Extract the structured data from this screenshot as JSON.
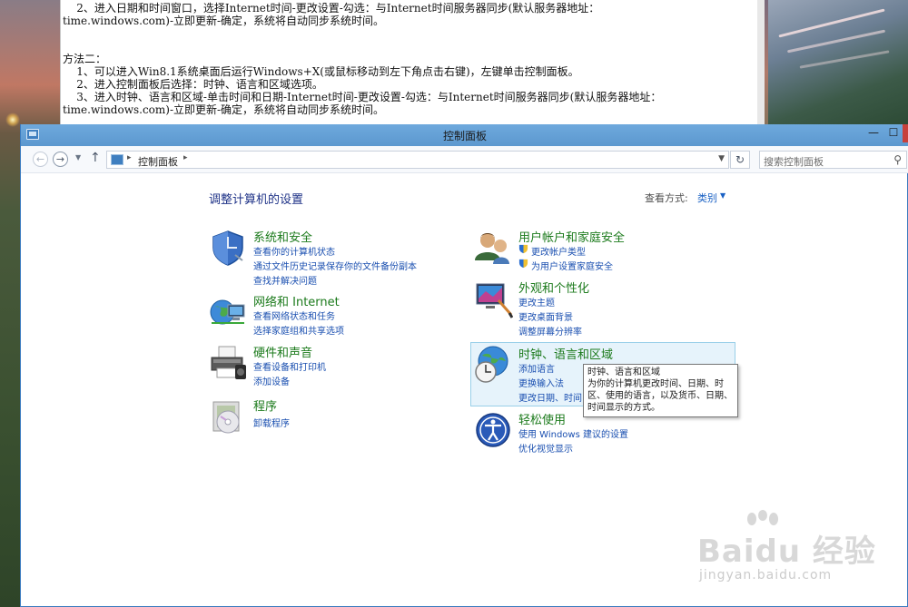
{
  "notepad": {
    "lines": [
      "    2、进入日期和时间窗口，选择Internet时间-更改设置-勾选：与Internet时间服务器同步(默认服务器地址：",
      "time.windows.com)-立即更新-确定，系统将自动同步系统时间。",
      "",
      "",
      "方法二：",
      "    1、可以进入Win8.1系统桌面后运行Windows+X(或鼠标移动到左下角点击右键)，左键单击控制面板。",
      "    2、进入控制面板后选择：时钟、语言和区域选项。",
      "    3、进入时钟、语言和区域-单击时间和日期-Internet时间-更改设置-勾选：与Internet时间服务器同步(默认服务器地址：",
      "time.windows.com)-立即更新-确定，系统将自动同步系统时间。"
    ]
  },
  "window": {
    "title": "控制面板",
    "minimize": "—",
    "maximize": "☐",
    "close": "✕"
  },
  "address": {
    "path": "控制面板",
    "search_placeholder": "搜索控制面板"
  },
  "content": {
    "page_title": "调整计算机的设置",
    "view_label": "查看方式:",
    "view_value": "类别"
  },
  "categories": [
    {
      "title": "系统和安全",
      "links": [
        "查看你的计算机状态",
        "通过文件历史记录保存你的文件备份副本",
        "查找并解决问题"
      ]
    },
    {
      "title": "网络和 Internet",
      "links": [
        "查看网络状态和任务",
        "选择家庭组和共享选项"
      ]
    },
    {
      "title": "硬件和声音",
      "links": [
        "查看设备和打印机",
        "添加设备"
      ]
    },
    {
      "title": "程序",
      "links": [
        "卸载程序"
      ]
    },
    {
      "title": "用户帐户和家庭安全",
      "links": [
        "更改帐户类型",
        "为用户设置家庭安全"
      ]
    },
    {
      "title": "外观和个性化",
      "links": [
        "更改主题",
        "更改桌面背景",
        "调整屏幕分辨率"
      ]
    },
    {
      "title": "时钟、语言和区域",
      "links": [
        "添加语言",
        "更换输入法",
        "更改日期、时间"
      ]
    },
    {
      "title": "轻松使用",
      "links": [
        "使用 Windows 建议的设置",
        "优化视觉显示"
      ]
    }
  ],
  "tooltip": {
    "lines": [
      "时钟、语言和区域",
      "为你的计算机更改时间、日期、时",
      "区、使用的语言，以及货币、日期、",
      "时间显示的方式。"
    ]
  },
  "watermark": {
    "brand": "Baidu 经验",
    "site": "jingyan.baidu.com"
  },
  "colors": {
    "category_title": "#1b7a1b",
    "link": "#1a4fb0",
    "titlebar": "#5c98cf",
    "hover_bg": "#e6f3fb"
  }
}
